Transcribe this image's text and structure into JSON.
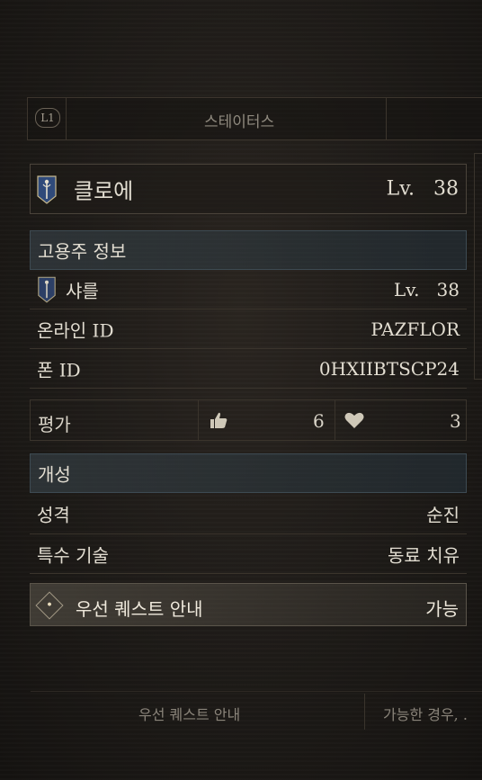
{
  "tabs": {
    "shoulder_button": "L1",
    "title": "스테이터스"
  },
  "character": {
    "name": "클로에",
    "level_label": "Lv.",
    "level": "38",
    "icon": "staff-emblem-icon"
  },
  "employer": {
    "section_title": "고용주 정보",
    "name": "샤를",
    "level_label": "Lv.",
    "level": "38",
    "online_id_label": "온라인 ID",
    "online_id": "PAZFLOR",
    "phone_id_label": "폰 ID",
    "phone_id": "0HXIIBTSCP24"
  },
  "rating": {
    "label": "평가",
    "likes": "6",
    "hearts": "3"
  },
  "traits": {
    "section_title": "개성",
    "personality_label": "성격",
    "personality": "순진",
    "skill_label": "특수 기술",
    "skill": "동료 치유"
  },
  "quest": {
    "label": "우선 퀘스트 안내",
    "value": "가능"
  },
  "footer": {
    "left": "우선 퀘스트 안내",
    "right": "가능한 경우, ."
  }
}
